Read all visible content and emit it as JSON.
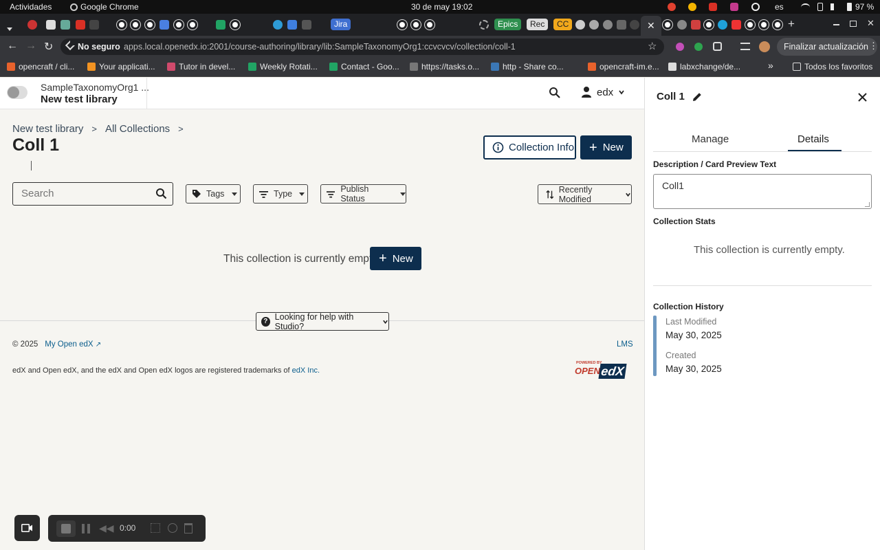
{
  "os": {
    "activities": "Actividades",
    "app": "Google Chrome",
    "datetime": "30 de may  19:02",
    "lang": "es",
    "battery": "97 %"
  },
  "tabs": {
    "jira": "Jira",
    "epics": "Epics",
    "rec": "Rec",
    "cc": "CC"
  },
  "addressbar": {
    "security": "No seguro",
    "url": "apps.local.openedx.io:2001/course-authoring/library/lib:SampleTaxonomyOrg1:ccvcvcv/collection/coll-1",
    "update": "Finalizar actualización"
  },
  "bookmarks": [
    {
      "label": "opencraft / cli...",
      "color": "#e8622c"
    },
    {
      "label": "Your applicati...",
      "color": "#f29322"
    },
    {
      "label": "Tutor in devel...",
      "color": "#d04a6c"
    },
    {
      "label": "Weekly Rotati...",
      "color": "#21a464"
    },
    {
      "label": "Contact - Goo...",
      "color": "#21a464"
    },
    {
      "label": "https://tasks.o...",
      "color": "#777777"
    },
    {
      "label": "http - Share co...",
      "color": "#3b77b5"
    },
    {
      "label": "opencraft-im.e...",
      "color": "#e8622c"
    },
    {
      "label": "labxchange/de...",
      "color": "#dddddd"
    }
  ],
  "bookmarks_all": "Todos los favoritos",
  "header": {
    "org": "SampleTaxonomyOrg1 ...",
    "library": "New test library",
    "user": "edx"
  },
  "breadcrumb": {
    "library": "New test library",
    "collections": "All Collections"
  },
  "page_title": "Coll 1",
  "actions": {
    "info": "Collection Info",
    "new": "New"
  },
  "search": {
    "placeholder": "Search"
  },
  "filters": {
    "tags": "Tags",
    "type": "Type",
    "publish": "Publish Status",
    "sort": "Recently Modified"
  },
  "empty": {
    "text": "This collection is currently empty.",
    "new": "New"
  },
  "help": "Looking for help with Studio?",
  "footer": {
    "copyright": "© 2025",
    "site": "My Open edX",
    "lms": "LMS",
    "trademark": "edX and Open edX, and the edX and Open edX logos are registered trademarks of",
    "edx_inc": "edX Inc.",
    "logo_small": "POWERED BY",
    "logo_open": "OPEN",
    "logo_edx": "edX"
  },
  "panel": {
    "title": "Coll 1",
    "tabs": {
      "manage": "Manage",
      "details": "Details"
    },
    "desc_label": "Description / Card Preview Text",
    "desc_value": "Coll1",
    "stats_label": "Collection Stats",
    "stats_empty": "This collection is currently empty.",
    "history_label": "Collection History",
    "modified_label": "Last Modified",
    "modified_value": "May 30, 2025",
    "created_label": "Created",
    "created_value": "May 30, 2025"
  },
  "recorder": {
    "time": "0:00"
  },
  "colors": {
    "brand": "#0d2e4e",
    "link": "#0a5d8c",
    "panel_accent": "#2c6fa5"
  }
}
